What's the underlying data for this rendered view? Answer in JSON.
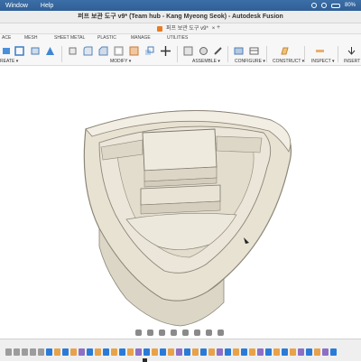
{
  "menubar": {
    "items": [
      "Window",
      "Help"
    ],
    "battery": "80%"
  },
  "window": {
    "title": "퍼프 보관 도구 v9* (Team hub - Kang Myeong Seok) - Autodesk Fusion"
  },
  "document_tab": {
    "label": "퍼프 보관 도구 v9*"
  },
  "workspace_tabs": [
    "ACE",
    "MESH",
    "SHEET METAL",
    "PLASTIC",
    "MANAGE",
    "UTILITIES"
  ],
  "toolbar": {
    "groups": [
      "REATE ▾",
      "MODIFY ▾",
      "ASSEMBLE ▾",
      "CONFIGURE ▾",
      "CONSTRUCT ▾",
      "INSPECT ▾",
      "INSERT"
    ]
  },
  "colors": {
    "accent": "#2a7bd8",
    "model_face": "#e8e2d3",
    "model_edge": "#8c8678"
  }
}
